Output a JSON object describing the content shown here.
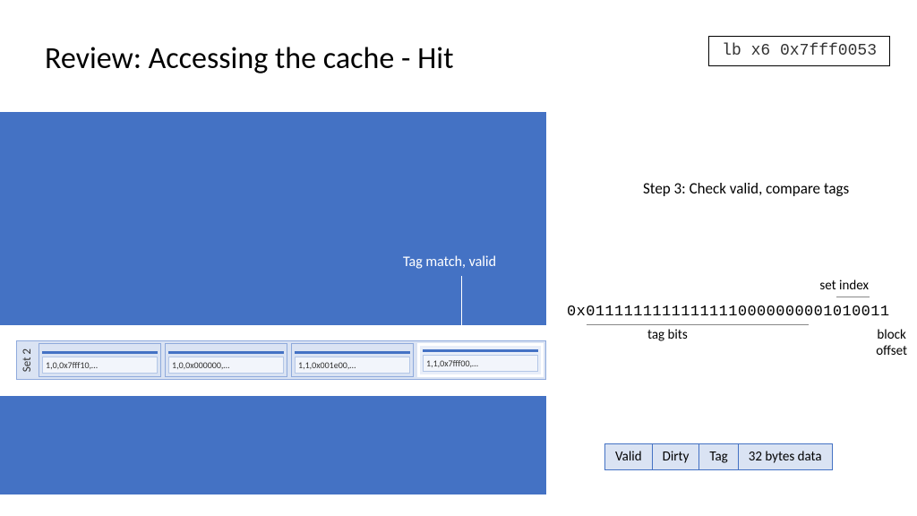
{
  "title": "Review: Accessing the cache - Hit",
  "code": "lb x6 0x7fff0053",
  "step": "Step 3: Check valid, compare tags",
  "callout": "Tag match, valid",
  "set_label": "Set 2",
  "ways": [
    "1,0,0x7fff10,…",
    "1,0,0x000000,…",
    "1,1,0x001e00,…",
    "1,1,0x7fff00,…"
  ],
  "addr": {
    "prefix": "0x",
    "bits": "01111111111111110000000001010011",
    "set_index_label": "set index",
    "tag_label": "tag bits",
    "block_offset_label_1": "block",
    "block_offset_label_2": "offset"
  },
  "legend": {
    "valid": "Valid",
    "dirty": "Dirty",
    "tag": "Tag",
    "data": "32 bytes data"
  }
}
